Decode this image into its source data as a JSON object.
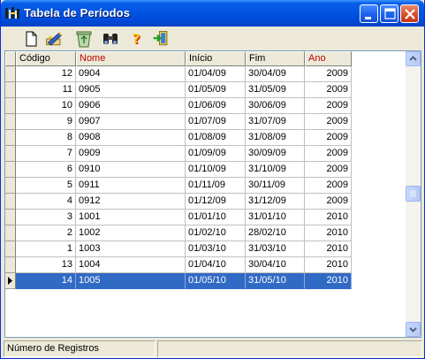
{
  "window": {
    "title": "Tabela de Períodos"
  },
  "toolbar": {
    "tools": [
      "new-icon",
      "edit-icon",
      "recycle-icon",
      "binoculars-icon",
      "help-icon",
      "exit-icon"
    ]
  },
  "grid": {
    "headers": [
      {
        "label": "Código",
        "highlight": false
      },
      {
        "label": "Nome",
        "highlight": true
      },
      {
        "label": "Início",
        "highlight": false
      },
      {
        "label": "Fim",
        "highlight": false
      },
      {
        "label": "Ano",
        "highlight": true
      }
    ],
    "rows": [
      {
        "codigo": "12",
        "nome": "0904",
        "inicio": "01/04/09",
        "fim": "30/04/09",
        "ano": "2009"
      },
      {
        "codigo": "11",
        "nome": "0905",
        "inicio": "01/05/09",
        "fim": "31/05/09",
        "ano": "2009"
      },
      {
        "codigo": "10",
        "nome": "0906",
        "inicio": "01/06/09",
        "fim": "30/06/09",
        "ano": "2009"
      },
      {
        "codigo": "9",
        "nome": "0907",
        "inicio": "01/07/09",
        "fim": "31/07/09",
        "ano": "2009"
      },
      {
        "codigo": "8",
        "nome": "0908",
        "inicio": "01/08/09",
        "fim": "31/08/09",
        "ano": "2009"
      },
      {
        "codigo": "7",
        "nome": "0909",
        "inicio": "01/09/09",
        "fim": "30/09/09",
        "ano": "2009"
      },
      {
        "codigo": "6",
        "nome": "0910",
        "inicio": "01/10/09",
        "fim": "31/10/09",
        "ano": "2009"
      },
      {
        "codigo": "5",
        "nome": "0911",
        "inicio": "01/11/09",
        "fim": "30/11/09",
        "ano": "2009"
      },
      {
        "codigo": "4",
        "nome": "0912",
        "inicio": "01/12/09",
        "fim": "31/12/09",
        "ano": "2009"
      },
      {
        "codigo": "3",
        "nome": "1001",
        "inicio": "01/01/10",
        "fim": "31/01/10",
        "ano": "2010"
      },
      {
        "codigo": "2",
        "nome": "1002",
        "inicio": "01/02/10",
        "fim": "28/02/10",
        "ano": "2010"
      },
      {
        "codigo": "1",
        "nome": "1003",
        "inicio": "01/03/10",
        "fim": "31/03/10",
        "ano": "2010"
      },
      {
        "codigo": "13",
        "nome": "1004",
        "inicio": "01/04/10",
        "fim": "30/04/10",
        "ano": "2010"
      },
      {
        "codigo": "14",
        "nome": "1005",
        "inicio": "01/05/10",
        "fim": "31/05/10",
        "ano": "2010",
        "selected": true
      }
    ]
  },
  "status": {
    "left": "Número de Registros",
    "right": ""
  },
  "colors": {
    "titlebar": "#0054e3",
    "selection": "#316ac5",
    "highlight_header": "#c00000"
  }
}
